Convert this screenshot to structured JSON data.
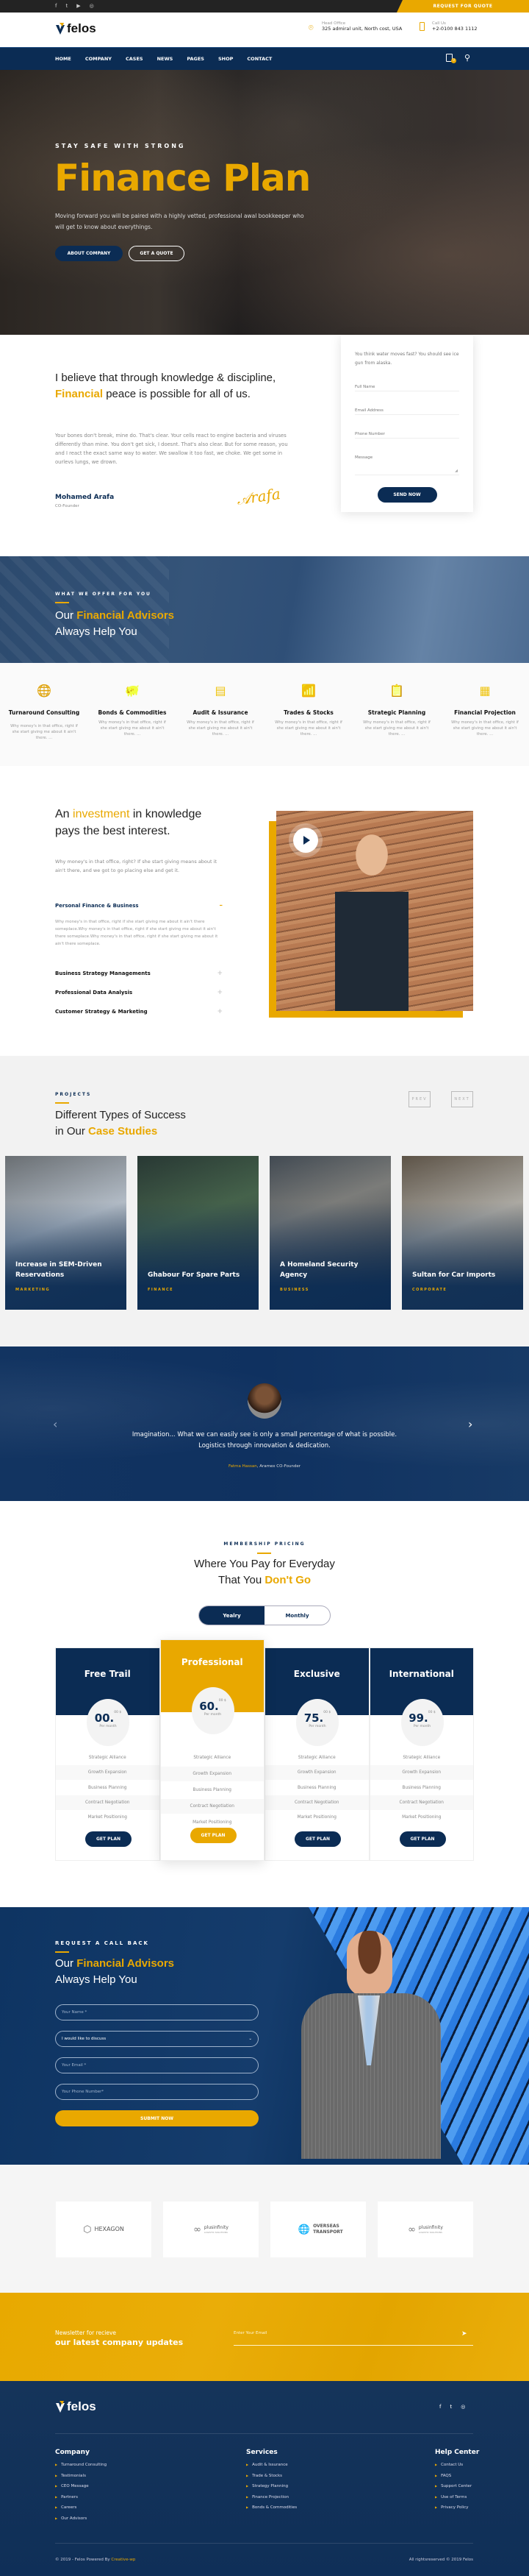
{
  "colors": {
    "navy": "#0b2c54",
    "accent": "#e9a800",
    "topbar": "#232323"
  },
  "topbar": {
    "social_icons": [
      "facebook-icon",
      "twitter-icon",
      "youtube-icon",
      "instagram-icon"
    ],
    "quote_button": "REQUEST FOR QUOTE"
  },
  "header": {
    "logo": "felos",
    "office_label": "Head Office",
    "office_value": "325 admiral unit, North cost, USA",
    "call_label": "Call Us",
    "call_value": "+2-0100 843 1112"
  },
  "nav": {
    "items": [
      "HOME",
      "COMPANY",
      "CASES",
      "NEWS",
      "PAGES",
      "SHOP",
      "CONTACT"
    ],
    "cart_count": "0"
  },
  "hero": {
    "kicker": "STAY SAFE WITH STRONG",
    "title": "Finance Plan",
    "text": "Moving forward you will be paired with a highly vetted, professional awal bookkeeper who will get to know about everythings.",
    "primary_button": "ABOUT COMPANY",
    "secondary_button": "GET A QUOTE"
  },
  "intro": {
    "heading_pre": "I believe that through knowledge & discipline, ",
    "heading_highlight": "Financial",
    "heading_post": " peace is possible for all of us.",
    "text": "Your bones don't break, mine do. That's clear. Your cells react to engine bacteria and viruses differently than mine. You don't get sick, I doesnt. That's also clear. But for some reason, you and I react the exact same way to water. We swallow it too fast, we choke. We get some in ourlevs lungs, we drown.",
    "name": "Mohamed Arafa",
    "role": "CO-Founder",
    "signature": "Arafa"
  },
  "contact_form": {
    "intro": "You think water moves fast? You should see ice gun from alaska.",
    "full_name": "Full Name",
    "email": "Email Address",
    "phone": "Phone Number",
    "message": "Message",
    "submit": "SEND NOW"
  },
  "offer": {
    "kicker": "WHAT WE OFFER FOR YOU",
    "heading_pre": "Our ",
    "heading_highlight": "Financial Advisors",
    "heading_line2": "Always Help You"
  },
  "services": [
    {
      "icon": "globe-location-icon",
      "title": "Turnaround Consulting",
      "text": "Why money's in that office, right if she start giving me about it ain't there. ..."
    },
    {
      "icon": "piggy-bank-icon",
      "title": "Bonds & Commodities",
      "text": "Why money's in that office, right if she start giving me about it ain't there. ..."
    },
    {
      "icon": "document-icon",
      "title": "Audit & Issurance",
      "text": "Why money's in that office, right if she start giving me about it ain't there. ..."
    },
    {
      "icon": "bar-chart-icon",
      "title": "Trades & Stocks",
      "text": "Why money's in that office, right if she start giving me about it ain't there. ..."
    },
    {
      "icon": "clipboard-check-icon",
      "title": "Strategic Planning",
      "text": "Why money's in that office, right if she start giving me about it ain't there. ..."
    },
    {
      "icon": "calculator-icon",
      "title": "Financial Projection",
      "text": "Why money's in that office, right if she start giving me about it ain't there. ..."
    }
  ],
  "investment": {
    "heading_pre": "An ",
    "heading_highlight": "investment",
    "heading_post": " in knowledge pays the best interest.",
    "text": "Why money's in that office, right? If she start giving means about it ain't there, and we got to go placing else and get it.",
    "accordion": [
      {
        "title": "Personal Finance & Business",
        "open": true,
        "text": "Why money's in that office, right if she start giving me about it ain't there someplace.Why money's in that office, right if she start giving me about it ain't there someplace.Why money's in that office, right if she start giving me about it ain't there someplace."
      },
      {
        "title": "Business Strategy Managements",
        "open": false
      },
      {
        "title": "Professional Data Analysis",
        "open": false
      },
      {
        "title": "Customer Strategy & Marketing",
        "open": false
      }
    ]
  },
  "projects": {
    "kicker": "PROJECTS",
    "heading_line1": "Different Types of Success",
    "heading_pre": "in Our ",
    "heading_highlight": "Case Studies",
    "prev": "PREV",
    "next": "NEXT",
    "cases": [
      {
        "title": "Increase in SEM-Driven Reservations",
        "category": "MARKETING"
      },
      {
        "title": "Ghabour For Spare Parts",
        "category": "FINANCE"
      },
      {
        "title": "A Homeland Security Agency",
        "category": "BUSINESS"
      },
      {
        "title": "Sultan for Car Imports",
        "category": "CORPORATE"
      }
    ]
  },
  "testimonial": {
    "quote": "Imagination... What we can easily see is only a small percentage of what is possible. Logistics through innovation & dedication.",
    "author": "Fatma Hassan",
    "author_role": ", Aramex CO-Founder"
  },
  "pricing": {
    "kicker": "MEMBERSHIP PRICING",
    "heading_line1": "Where You Pay for Everyday",
    "heading_pre": "That You ",
    "heading_highlight": "Don't Go",
    "toggle": [
      "Yealry",
      "Monthly"
    ],
    "toggle_active": "Yealry",
    "plans": [
      {
        "name": "Free Trail",
        "price": "00.",
        "cents": "00 $",
        "period": "Per month",
        "featured": false
      },
      {
        "name": "Professional",
        "price": "60.",
        "cents": "00 $",
        "period": "Per month",
        "featured": true
      },
      {
        "name": "Exclusive",
        "price": "75.",
        "cents": "00 $",
        "period": "Per month",
        "featured": false
      },
      {
        "name": "International",
        "price": "99.",
        "cents": "00 $",
        "period": "Per month",
        "featured": false
      }
    ],
    "features": [
      "Strategic Alliance",
      "Growth Expansion",
      "Business Planning",
      "Contract Negotiation",
      "Market Positioning"
    ],
    "button": "GET PLAN"
  },
  "callback": {
    "kicker": "REQUEST A CALL BACK",
    "heading_pre": "Our ",
    "heading_highlight": "Financial Advisors",
    "heading_line2": "Always Help You",
    "name_placeholder": "Your Name *",
    "select_value": "I would like to discuss",
    "email_placeholder": "Your Email *",
    "phone_placeholder": "Your Phone Number*",
    "submit": "SUBMIT NOW"
  },
  "partners": [
    {
      "name": "HEXAGON"
    },
    {
      "name": "plusinfinity",
      "tagline": "LOGISTIC SOLUTIONS"
    },
    {
      "name": "OVERSEAS TRANSPORT"
    },
    {
      "name": "plusinfinity",
      "tagline": "LOGISTIC SOLUTIONS"
    }
  ],
  "newsletter": {
    "line1": "Newsletter for recieve",
    "line2": "our latest company updates",
    "placeholder": "Enter Your Email"
  },
  "footer": {
    "logo": "felos",
    "social_icons": [
      "facebook-icon",
      "twitter-icon",
      "instagram-icon"
    ],
    "columns": [
      {
        "title": "Company",
        "items": [
          "Turnaround Consulting",
          "Testimonials",
          "CEO Message",
          "Partners",
          "Careers",
          "Our Advisors"
        ]
      },
      {
        "title": "Services",
        "items": [
          "Audit & Issurance",
          "Trade & Stocks",
          "Strategy Planning",
          "Finance Projection",
          "Bonds & Commodities"
        ]
      },
      {
        "title": "Help Center",
        "items": [
          "Contact Us",
          "FAQS",
          "Support Center",
          "Use of Terms",
          "Privacy Policy"
        ]
      }
    ],
    "copyright_pre": "© 2019 - Felos Powered By ",
    "copyright_link": "Creative-wp",
    "rights": "All rightsreserved © 2019 Felos"
  }
}
